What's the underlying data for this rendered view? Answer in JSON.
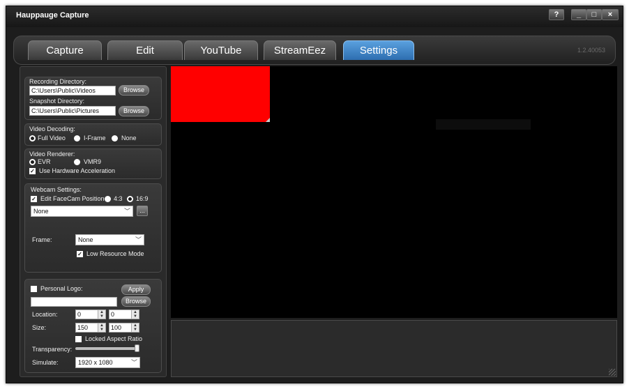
{
  "window": {
    "title": "Hauppauge Capture",
    "help_label": "?",
    "minimize_label": "_",
    "maximize_label": "□",
    "close_label": "×"
  },
  "tabs": [
    {
      "label": "Capture",
      "active": false
    },
    {
      "label": "Edit",
      "active": false
    },
    {
      "label": "YouTube",
      "active": false
    },
    {
      "label": "StreamEez",
      "active": false
    },
    {
      "label": "Settings",
      "active": true
    }
  ],
  "version": "1.2.40053",
  "recording": {
    "recording_dir_label": "Recording Directory:",
    "recording_dir_value": "C:\\Users\\Public\\Videos",
    "browse_label": "Browse",
    "snapshot_dir_label": "Snapshot Directory:",
    "snapshot_dir_value": "C:\\Users\\Public\\Pictures"
  },
  "video_decoding": {
    "label": "Video Decoding:",
    "options": [
      "Full Video",
      "I-Frame",
      "None"
    ],
    "selected": "Full Video"
  },
  "video_renderer": {
    "label": "Video Renderer:",
    "options": [
      "EVR",
      "VMR9"
    ],
    "selected": "EVR",
    "hw_accel_label": "Use Hardware Acceleration",
    "hw_accel_checked": true
  },
  "webcam": {
    "label": "Webcam Settings:",
    "edit_facecam_label": "Edit FaceCam Position",
    "edit_facecam_checked": true,
    "ratio_options": [
      "4:3",
      "16:9"
    ],
    "ratio_selected": "16:9",
    "device_value": "None",
    "more_label": "...",
    "frame_label": "Frame:",
    "frame_value": "None",
    "low_resource_label": "Low Resource Mode",
    "low_resource_checked": true
  },
  "logo": {
    "personal_logo_label": "Personal Logo:",
    "personal_logo_checked": false,
    "apply_label": "Apply",
    "browse_label": "Browse",
    "location_label": "Location:",
    "location_x": "0",
    "location_y": "0",
    "size_label": "Size:",
    "size_w": "150",
    "size_h": "100",
    "locked_aspect_label": "Locked Aspect Ratio",
    "locked_aspect_checked": false,
    "transparency_label": "Transparency:",
    "transparency_value": 1.0,
    "simulate_label": "Simulate:",
    "simulate_value": "1920 x 1080"
  },
  "colors": {
    "accent_tab": "#3f86c8",
    "facecam_box": "#ff0000",
    "preview_bg": "#000000"
  }
}
